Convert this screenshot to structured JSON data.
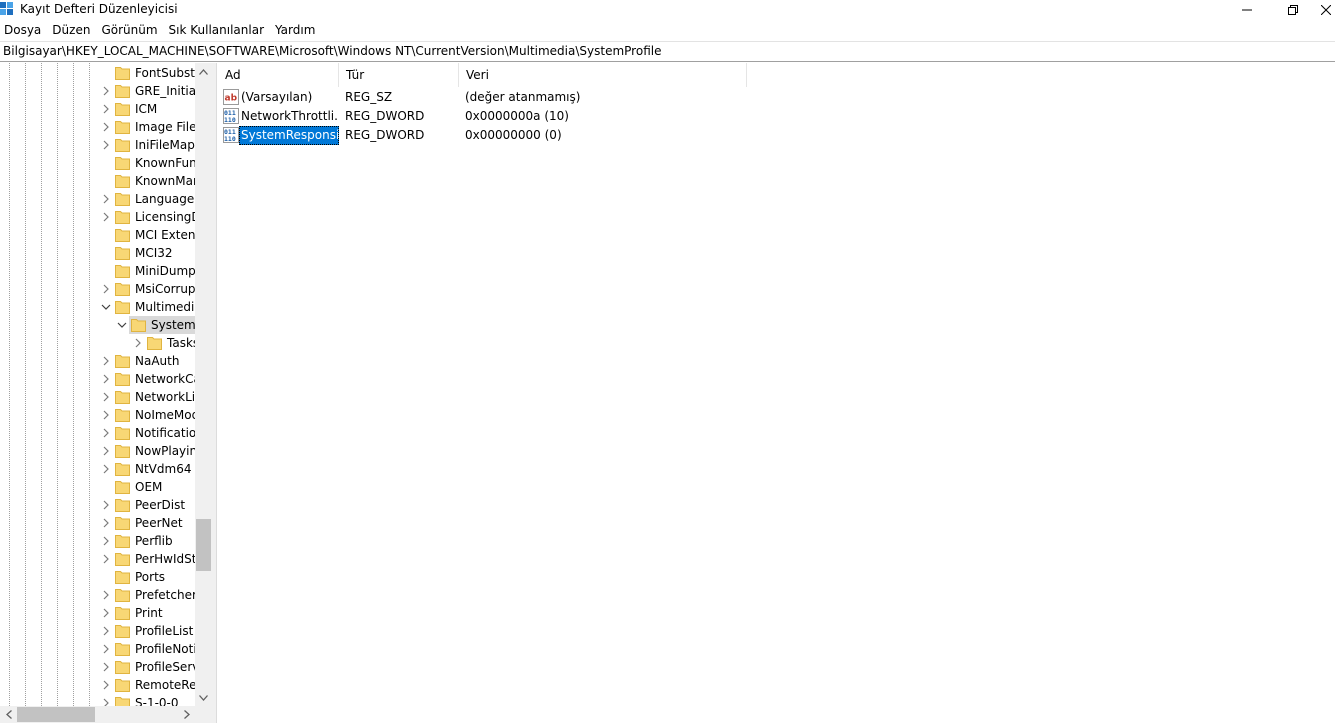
{
  "window": {
    "title": "Kayıt Defteri Düzenleyicisi",
    "minimize_glyph": "—",
    "close_glyph": "✕"
  },
  "menu": [
    "Dosya",
    "Düzen",
    "Görünüm",
    "Sık Kullanılanlar",
    "Yardım"
  ],
  "address": "Bilgisayar\\HKEY_LOCAL_MACHINE\\SOFTWARE\\Microsoft\\Windows NT\\CurrentVersion\\Multimedia\\SystemProfile",
  "tree": {
    "items": [
      {
        "label": "FontSubstitutes",
        "expander": "none",
        "selected": false
      },
      {
        "label": "GRE_Initialize",
        "expander": "collapsed",
        "selected": false
      },
      {
        "label": "ICM",
        "expander": "collapsed",
        "selected": false
      },
      {
        "label": "Image File Execution Options",
        "expander": "collapsed",
        "selected": false
      },
      {
        "label": "IniFileMapping",
        "expander": "collapsed",
        "selected": false
      },
      {
        "label": "KnownFunctionTableDlls",
        "expander": "none",
        "selected": false
      },
      {
        "label": "KnownManagedDebuggingDlls",
        "expander": "none",
        "selected": false
      },
      {
        "label": "LanguagePack",
        "expander": "collapsed",
        "selected": false
      },
      {
        "label": "LicensingDiag",
        "expander": "collapsed",
        "selected": false
      },
      {
        "label": "MCI Extensions",
        "expander": "none",
        "selected": false
      },
      {
        "label": "MCI32",
        "expander": "none",
        "selected": false
      },
      {
        "label": "MiniDumpAuxiliaryDlls",
        "expander": "none",
        "selected": false
      },
      {
        "label": "MsiCorruptedFileRecovery",
        "expander": "collapsed",
        "selected": false
      },
      {
        "label": "Multimedia",
        "expander": "expanded",
        "selected": false
      },
      {
        "label": "SystemProfile",
        "expander": "expanded",
        "selected": true
      },
      {
        "label": "Tasks",
        "expander": "collapsed",
        "selected": false
      },
      {
        "label": "NaAuth",
        "expander": "collapsed",
        "selected": false
      },
      {
        "label": "NetworkCards",
        "expander": "collapsed",
        "selected": false
      },
      {
        "label": "NetworkList",
        "expander": "collapsed",
        "selected": false
      },
      {
        "label": "NoImeModeImes",
        "expander": "collapsed",
        "selected": false
      },
      {
        "label": "Notifications",
        "expander": "collapsed",
        "selected": false
      },
      {
        "label": "NowPlayingSessionManager",
        "expander": "collapsed",
        "selected": false
      },
      {
        "label": "NtVdm64",
        "expander": "collapsed",
        "selected": false
      },
      {
        "label": "OEM",
        "expander": "none",
        "selected": false
      },
      {
        "label": "PeerDist",
        "expander": "collapsed",
        "selected": false
      },
      {
        "label": "PeerNet",
        "expander": "collapsed",
        "selected": false
      },
      {
        "label": "Perflib",
        "expander": "collapsed",
        "selected": false
      },
      {
        "label": "PerHwIdStorage",
        "expander": "collapsed",
        "selected": false
      },
      {
        "label": "Ports",
        "expander": "none",
        "selected": false
      },
      {
        "label": "Prefetcher",
        "expander": "collapsed",
        "selected": false
      },
      {
        "label": "Print",
        "expander": "collapsed",
        "selected": false
      },
      {
        "label": "ProfileList",
        "expander": "collapsed",
        "selected": false
      },
      {
        "label": "ProfileNotification",
        "expander": "collapsed",
        "selected": false
      },
      {
        "label": "ProfileService",
        "expander": "collapsed",
        "selected": false
      },
      {
        "label": "RemoteRegistry",
        "expander": "collapsed",
        "selected": false
      },
      {
        "label": "S-1-0-0",
        "expander": "collapsed",
        "selected": false
      }
    ]
  },
  "list": {
    "columns": [
      "Ad",
      "Tür",
      "Veri"
    ],
    "rows": [
      {
        "icon": "string-value-icon",
        "name": "(Varsayılan)",
        "type": "REG_SZ",
        "data": "(değer atanmamış)",
        "selected": false
      },
      {
        "icon": "binary-value-icon",
        "name": "NetworkThrottli...",
        "type": "REG_DWORD",
        "data": "0x0000000a (10)",
        "selected": false
      },
      {
        "icon": "binary-value-icon",
        "name": "SystemResponsi...",
        "type": "REG_DWORD",
        "data": "0x00000000 (0)",
        "selected": true
      }
    ]
  },
  "colors": {
    "selection": "#0078d7",
    "folder": "#f8d775",
    "folder_edge": "#e0b440"
  }
}
